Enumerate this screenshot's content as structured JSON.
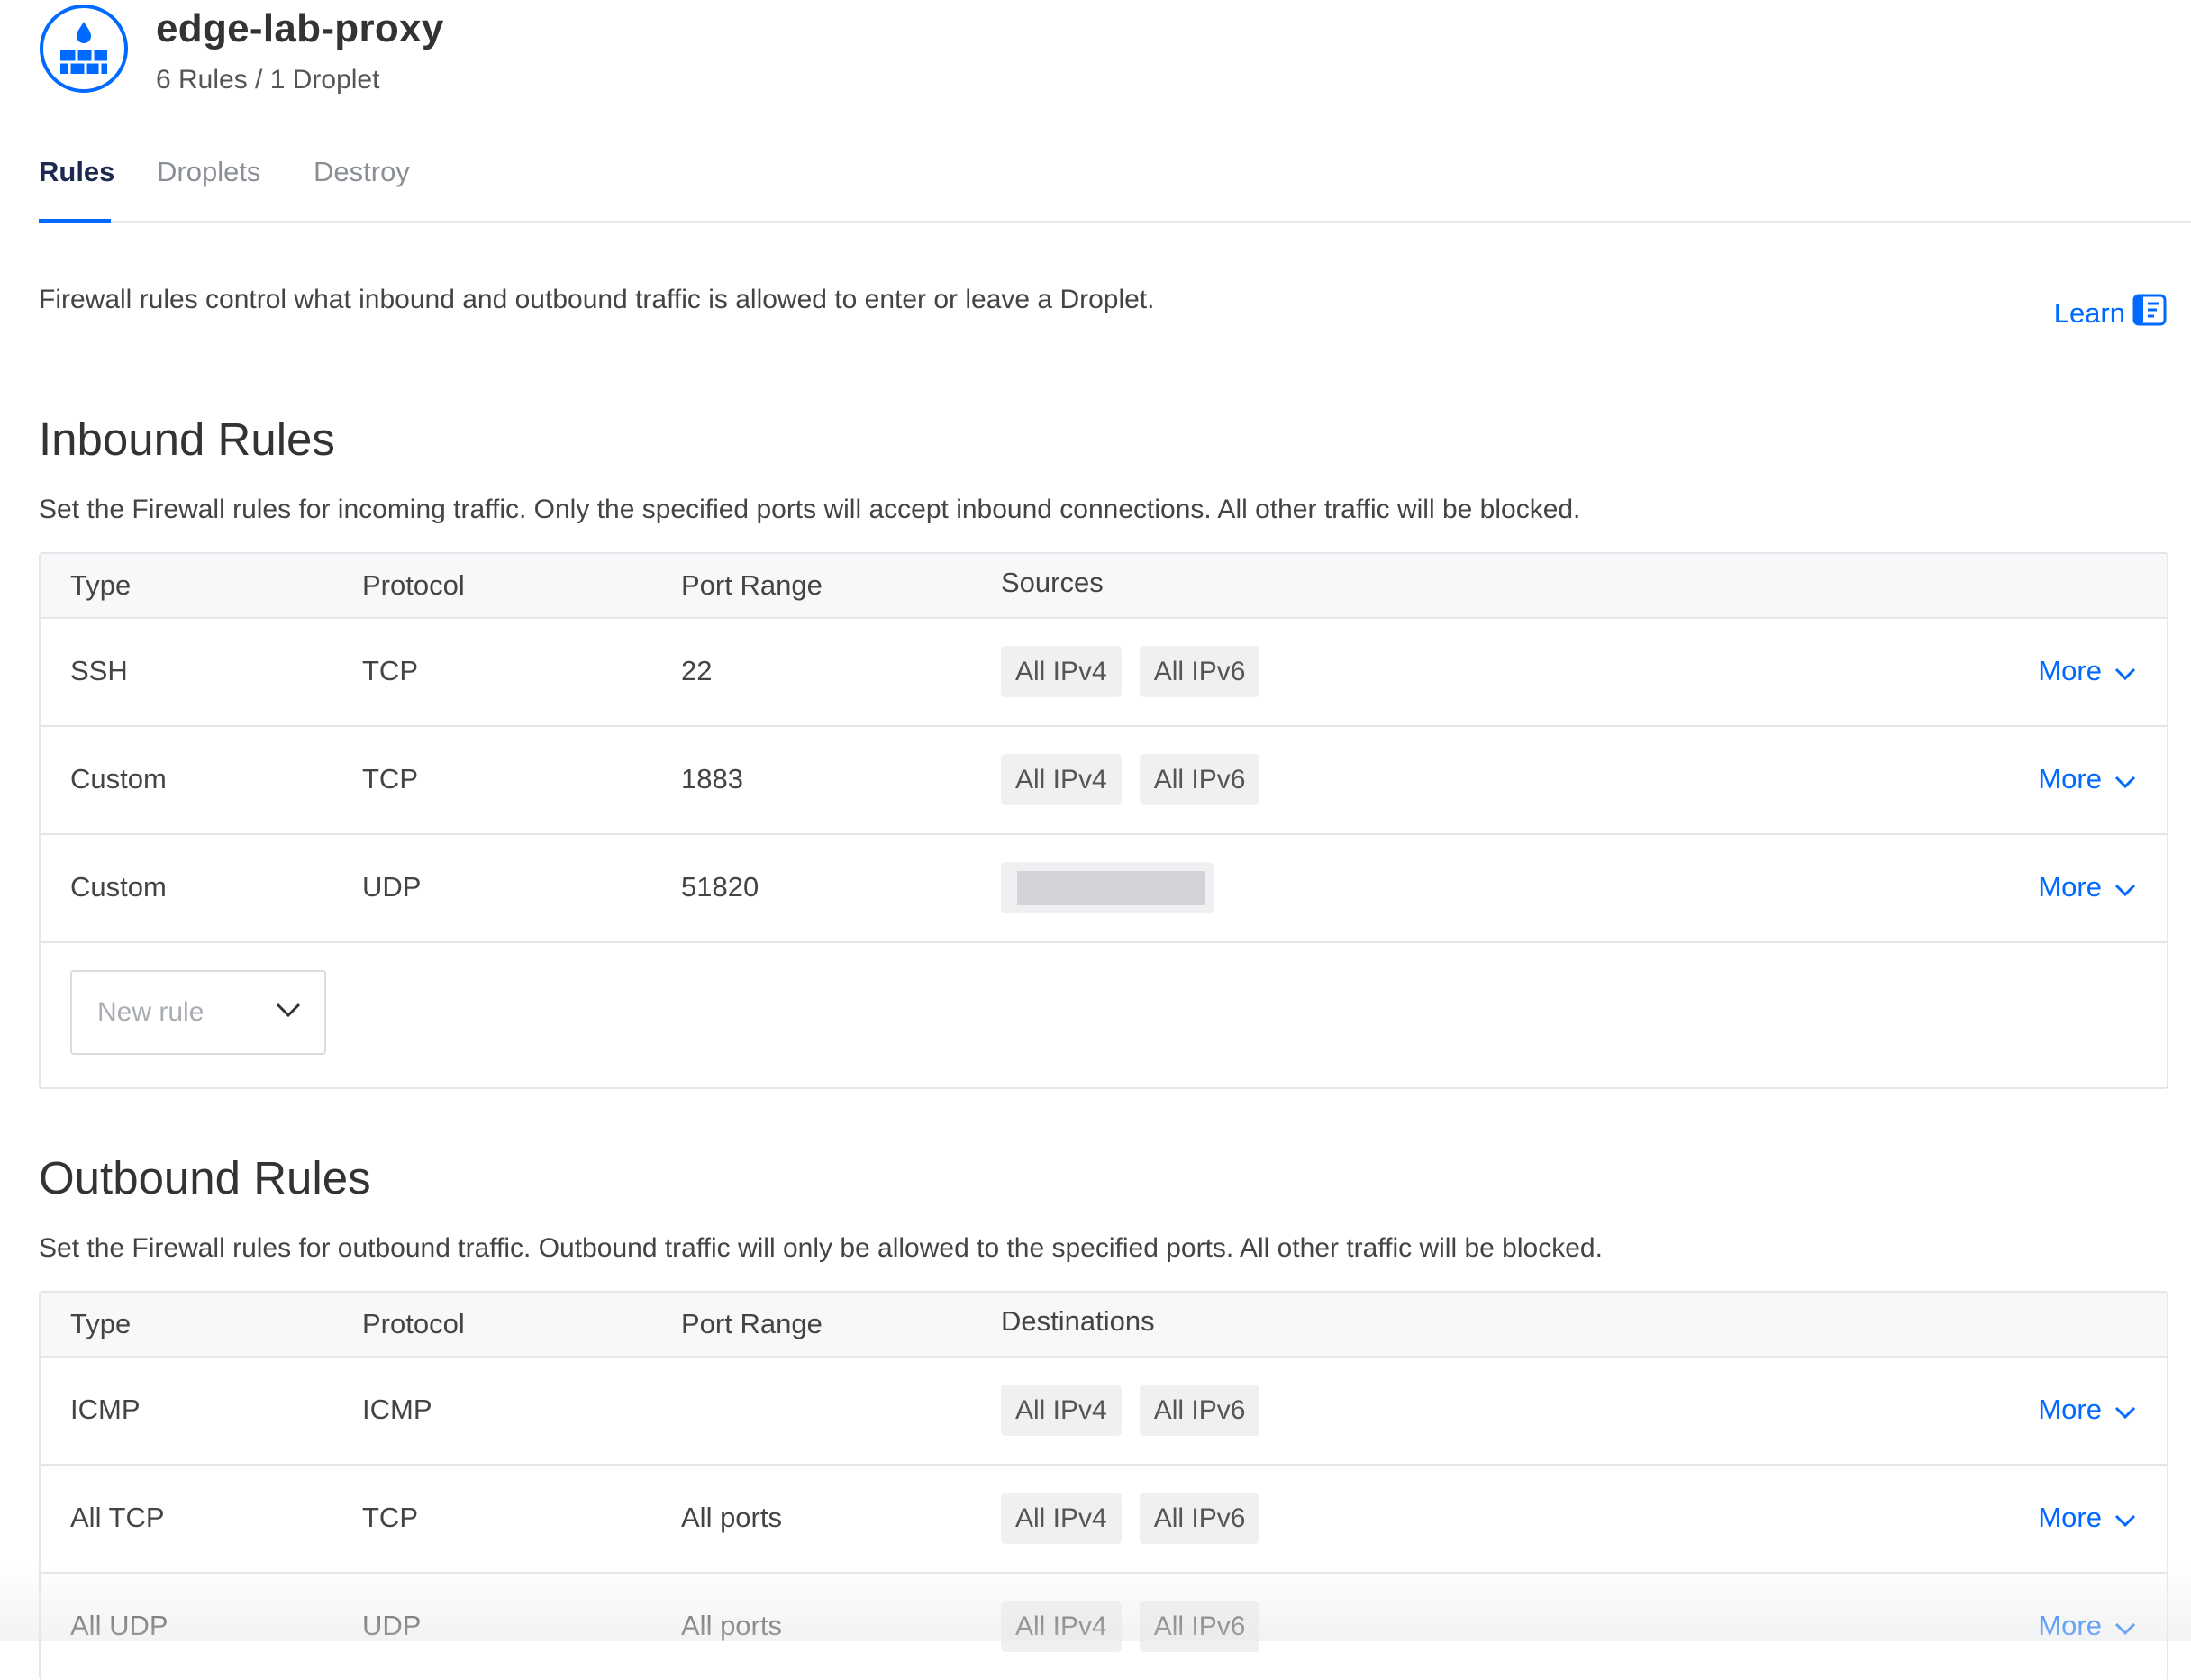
{
  "header": {
    "title": "edge-lab-proxy",
    "subtitle": "6 Rules / 1 Droplet",
    "icon": "firewall-icon",
    "accent_color": "#0069ff"
  },
  "tabs": [
    {
      "label": "Rules",
      "active": true
    },
    {
      "label": "Droplets",
      "active": false
    },
    {
      "label": "Destroy",
      "active": false
    }
  ],
  "intro": {
    "text": "Firewall rules control what inbound and outbound traffic is allowed to enter or leave a Droplet.",
    "learn_label": "Learn",
    "learn_icon": "document-icon"
  },
  "inbound": {
    "title": "Inbound Rules",
    "description": "Set the Firewall rules for incoming traffic. Only the specified ports will accept inbound connections. All other traffic will be blocked.",
    "columns": {
      "type": "Type",
      "protocol": "Protocol",
      "port_range": "Port Range",
      "sources": "Sources"
    },
    "rows": [
      {
        "type": "SSH",
        "protocol": "TCP",
        "port": "22",
        "chips": [
          "All IPv4",
          "All IPv6"
        ],
        "more": "More"
      },
      {
        "type": "Custom",
        "protocol": "TCP",
        "port": "1883",
        "chips": [
          "All IPv4",
          "All IPv6"
        ],
        "more": "More"
      },
      {
        "type": "Custom",
        "protocol": "UDP",
        "port": "51820",
        "chips": [],
        "redacted": true,
        "more": "More"
      }
    ],
    "new_rule_placeholder": "New rule"
  },
  "outbound": {
    "title": "Outbound Rules",
    "description": "Set the Firewall rules for outbound traffic. Outbound traffic will only be allowed to the specified ports. All other traffic will be blocked.",
    "columns": {
      "type": "Type",
      "protocol": "Protocol",
      "port_range": "Port Range",
      "destinations": "Destinations"
    },
    "rows": [
      {
        "type": "ICMP",
        "protocol": "ICMP",
        "port": "",
        "chips": [
          "All IPv4",
          "All IPv6"
        ],
        "more": "More"
      },
      {
        "type": "All TCP",
        "protocol": "TCP",
        "port": "All ports",
        "chips": [
          "All IPv4",
          "All IPv6"
        ],
        "more": "More"
      },
      {
        "type": "All UDP",
        "protocol": "UDP",
        "port": "All ports",
        "chips": [
          "All IPv4",
          "All IPv6"
        ],
        "more": "More"
      }
    ]
  }
}
